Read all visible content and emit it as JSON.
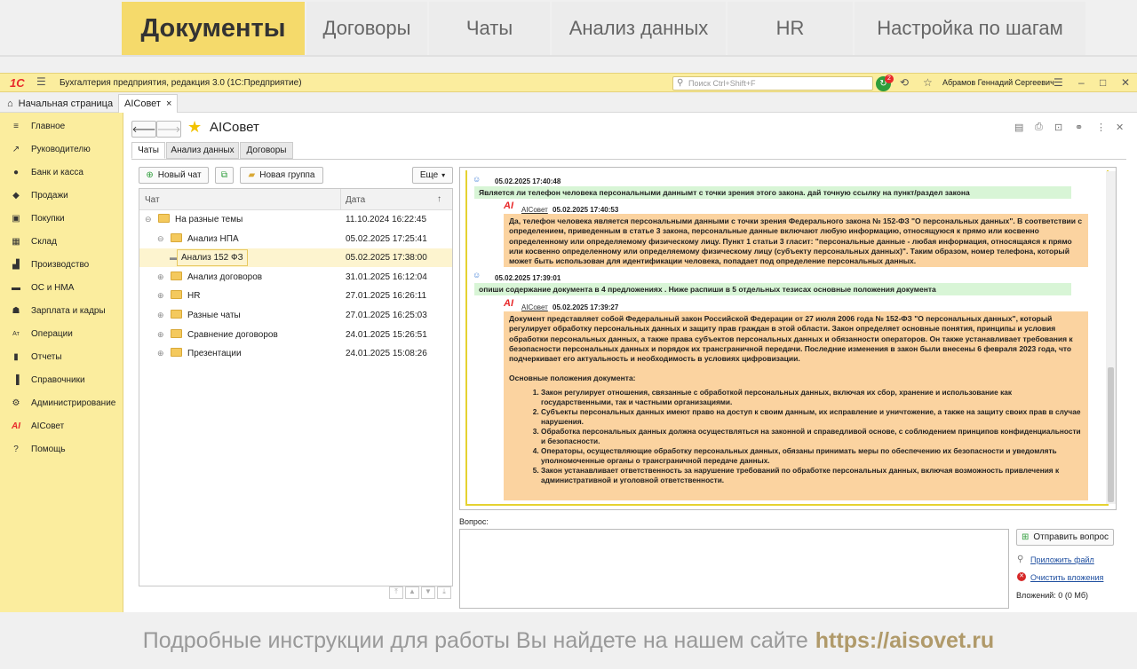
{
  "promo": {
    "tabs": [
      "Документы",
      "Договоры",
      "Чаты",
      "Анализ данных",
      "HR",
      "Настройка по шагам"
    ]
  },
  "app": {
    "logo": "1С",
    "menu_icon": "hamburger-icon",
    "title": "Бухгалтерия предприятия, редакция 3.0  (1С:Предприятие)",
    "search_placeholder": "Поиск Ctrl+Shift+F",
    "notifications": "2",
    "user": "Абрамов Геннадий Сергеевич"
  },
  "win_tabs": {
    "home": "Начальная страница",
    "active": "AIСовет",
    "close": "×"
  },
  "sidebar": {
    "items": [
      "Главное",
      "Руководителю",
      "Банк и касса",
      "Продажи",
      "Покупки",
      "Склад",
      "Производство",
      "ОС и НМА",
      "Зарплата и кадры",
      "Операции",
      "Отчеты",
      "Справочники",
      "Администрирование",
      "AIСовет",
      "Помощь"
    ]
  },
  "form": {
    "title": "AIСовет",
    "tabs": [
      "Чаты",
      "Анализ данных",
      "Договоры"
    ],
    "new_chat": "Новый чат",
    "new_group": "Новая группа",
    "more": "Еще",
    "more_arrow": "▾"
  },
  "tree": {
    "col_chat": "Чат",
    "col_date": "Дата",
    "sort_icon": "↑",
    "rows": [
      {
        "name": "На разные темы",
        "date": "11.10.2024 16:22:45",
        "level": 0,
        "expand": "⊖"
      },
      {
        "name": "Анализ НПА",
        "date": "05.02.2025 17:25:41",
        "level": 1,
        "expand": "⊖"
      },
      {
        "name": "Анализ 152 ФЗ",
        "date": "05.02.2025 17:38:00",
        "level": 2,
        "expand": "▬",
        "selected": true
      },
      {
        "name": "Анализ договоров",
        "date": "31.01.2025 16:12:04",
        "level": 1,
        "expand": "⊕"
      },
      {
        "name": "HR",
        "date": "27.01.2025 16:26:11",
        "level": 1,
        "expand": "⊕"
      },
      {
        "name": "Разные чаты",
        "date": "27.01.2025 16:25:03",
        "level": 1,
        "expand": "⊕"
      },
      {
        "name": "Сравнение договоров",
        "date": "24.01.2025 15:26:51",
        "level": 1,
        "expand": "⊕"
      },
      {
        "name": "Презентации",
        "date": "24.01.2025 15:08:26",
        "level": 1,
        "expand": "⊕"
      }
    ]
  },
  "chat": {
    "q1_time": "05.02.2025 17:40:48",
    "q1": "Является ли телефон человека персональными даннымт с точки зрения этого закона. дай точную ссылку на пункт/раздел закона",
    "ai_mark": "AI",
    "ai_name": "AIСовет",
    "a1_time": "05.02.2025 17:40:53",
    "a1": "Да, телефон человека является персональными данными с точки зрения Федерального закона № 152-ФЗ \"О персональных данных\". В соответствии с определением, приведенным в статье 3 закона, персональные данные включают любую информацию, относящуюся к прямо или косвенно определенному или определяемому физическому лицу. Пункт 1 статьи 3 гласит: \"персональные данные - любая информация, относящаяся к прямо или косвенно определенному или определяемому физическому лицу (субъекту персональных данных)\". Таким образом, номер телефона, который может быть использован для идентификации человека, попадает под определение персональных данных.",
    "q2_time": "05.02.2025 17:39:01",
    "q2": "опиши содержание документа в 4 предложениях . Ниже распиши в 5 отдельных тезисах основные положения документа",
    "a2_time": "05.02.2025 17:39:27",
    "a2_intro": "Документ представляет собой Федеральный закон Российской Федерации от 27 июля 2006 года № 152-ФЗ \"О персональных данных\", который регулирует обработку персональных данных и защиту прав граждан в этой области. Закон определяет основные понятия, принципы и условия обработки персональных данных, а также права субъектов персональных данных и обязанности операторов. Он также устанавливает требования к безопасности персональных данных и порядок их трансграничной передачи. Последние изменения в закон были внесены 6 февраля 2023 года, что подчеркивает его актуальность и необходимость в условиях цифровизации.",
    "a2_sub": "Основные положения документа:",
    "a2_list": [
      "Закон регулирует отношения, связанные с обработкой персональных данных, включая их сбор, хранение и использование как государственными, так и частными организациями.",
      "Субъекты персональных данных имеют право на доступ к своим данным, их исправление и уничтожение, а также на защиту своих прав в случае нарушения.",
      "Обработка персональных данных должна осуществляться на законной и справедливой основе, с соблюдением принципов конфиденциальности и безопасности.",
      "Операторы, осуществляющие обработку персональных данных, обязаны принимать меры по обеспечению их безопасности и уведомлять уполномоченные органы о трансграничной передаче данных.",
      "Закон устанавливает ответственность за нарушение требований по обработке персональных данных, включая возможность привлечения к административной и уголовной ответственности."
    ]
  },
  "question": {
    "label": "Вопрос:",
    "send": "Отправить вопрос",
    "attach": "Приложить файл",
    "clear": "Очистить вложения",
    "attachments": "Вложений: 0 (0 Мб)"
  },
  "footer": {
    "text": "Подробные инструкции для работы Вы найдете на нашем сайте",
    "url": "https://aisovet.ru"
  },
  "colors": {
    "accent": "#f5da6b",
    "sidebar": "#fbed9e",
    "question_bg": "#d8f5d6",
    "answer_bg": "#fbd3a0",
    "ai_red": "#e8292b"
  }
}
